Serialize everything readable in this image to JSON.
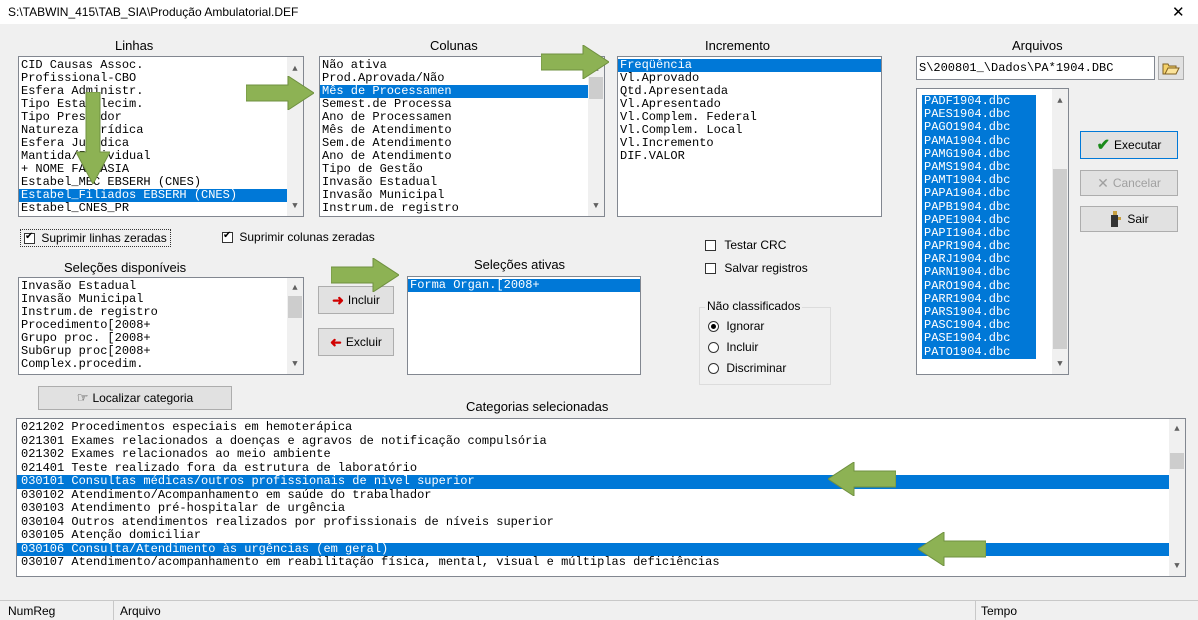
{
  "window": {
    "title": "S:\\TABWIN_415\\TAB_SIA\\Produção Ambulatorial.DEF",
    "close_glyph": "✕"
  },
  "linhas": {
    "header": "Linhas",
    "items": [
      "CID Causas Assoc.",
      "Profissional-CBO",
      "Esfera Administr.",
      "Tipo Estabelecim.",
      "Tipo Prestador",
      "Natureza Jurídica",
      "Esfera Jurídica",
      "Mantida/Individual",
      "+ NOME FANTASIA",
      "Estabel_MEC EBSERH (CNES)",
      "Estabel_Filiados EBSERH (CNES)",
      "Estabel_CNES_PR"
    ],
    "selected_index": 10
  },
  "colunas": {
    "header": "Colunas",
    "items": [
      "Não ativa",
      "Prod.Aprovada/Não",
      "Mês de Processamen",
      "Semest.de Processa",
      "Ano de Processamen",
      "Mês de Atendimento",
      "Sem.de Atendimento",
      "Ano de Atendimento",
      "Tipo de Gestão",
      "Invasão Estadual",
      "Invasão Municipal",
      "Instrum.de registro"
    ],
    "selected_index": 2
  },
  "incremento": {
    "header": "Incremento",
    "items": [
      "Freqüência",
      "Vl.Aprovado",
      "Qtd.Apresentada",
      "Vl.Apresentado",
      "Vl.Complem. Federal",
      "Vl.Complem. Local",
      "Vl.Incremento",
      "DIF.VALOR"
    ],
    "selected_index": 0
  },
  "arquivos": {
    "header": "Arquivos",
    "path": "S\\200801_\\Dados\\PA*1904.DBC",
    "items": [
      "PADF1904.dbc",
      "PAES1904.dbc",
      "PAGO1904.dbc",
      "PAMA1904.dbc",
      "PAMG1904.dbc",
      "PAMS1904.dbc",
      "PAMT1904.dbc",
      "PAPA1904.dbc",
      "PAPB1904.dbc",
      "PAPE1904.dbc",
      "PAPI1904.dbc",
      "PAPR1904.dbc",
      "PARJ1904.dbc",
      "PARN1904.dbc",
      "PARO1904.dbc",
      "PARR1904.dbc",
      "PARS1904.dbc",
      "PASC1904.dbc",
      "PASE1904.dbc",
      "PATO1904.dbc"
    ]
  },
  "buttons": {
    "executar": "Executar",
    "cancelar": "Cancelar",
    "sair": "Sair",
    "incluir": "Incluir",
    "excluir": "Excluir",
    "localizar": "Localizar categoria"
  },
  "options": {
    "suprimir_linhas": "Suprimir linhas zeradas",
    "suprimir_colunas": "Suprimir colunas zeradas",
    "testar_crc": "Testar CRC",
    "salvar_registros": "Salvar registros"
  },
  "nao_classificados": {
    "legend": "Não classificados",
    "ignorar": "Ignorar",
    "incluir": "Incluir",
    "discriminar": "Discriminar"
  },
  "selecoes_disponiveis": {
    "header": "Seleções disponíveis",
    "items": [
      "Invasão Estadual",
      "Invasão Municipal",
      "Instrum.de registro",
      "Procedimento[2008+",
      "Grupo proc. [2008+",
      "SubGrup proc[2008+",
      "Complex.procedim."
    ]
  },
  "selecoes_ativas": {
    "header": "Seleções ativas",
    "items": [
      "Forma Organ.[2008+"
    ]
  },
  "categorias": {
    "header": "Categorias selecionadas",
    "items": [
      "021202 Procedimentos especiais em hemoterápica",
      "021301 Exames relacionados a doenças e agravos de notificação compulsória",
      "021302 Exames relacionados ao meio ambiente",
      "021401 Teste realizado fora da estrutura de laboratório",
      "030101 Consultas médicas/outros profissionais  de nivel superior",
      "030102 Atendimento/Acompanhamento em saúde do trabalhador",
      "030103 Atendimento pré-hospitalar de urgência",
      "030104 Outros atendimentos realizados por profissionais de níveis superior",
      "030105 Atenção domiciliar",
      "030106 Consulta/Atendimento às urgências (em geral)",
      "030107 Atendimento/acompanhamento em reabilitação física, mental, visual e múltiplas deficiências"
    ]
  },
  "status": {
    "numreg": "NumReg",
    "arquivo": "Arquivo",
    "tempo": "Tempo"
  },
  "colors": {
    "selection": "#0078d7",
    "arrow": "#8db254"
  }
}
